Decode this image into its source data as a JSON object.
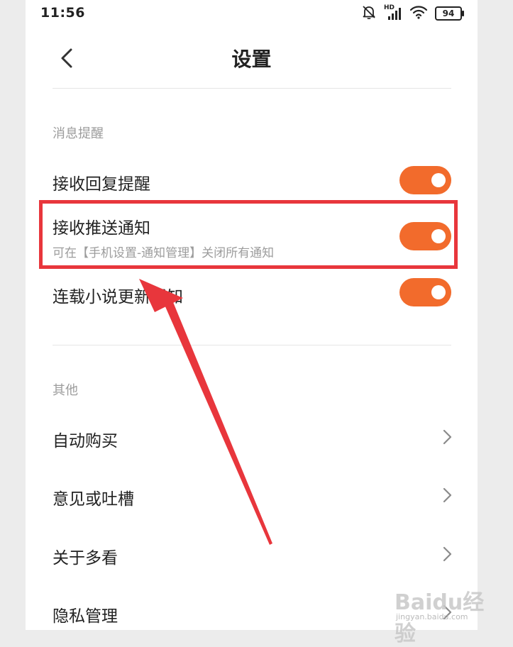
{
  "status_bar": {
    "time": "11:56",
    "network_label": "HD",
    "battery": "94"
  },
  "header": {
    "title": "设置"
  },
  "sections": {
    "notifications": {
      "title": "消息提醒",
      "items": [
        {
          "label": "接收回复提醒",
          "enabled": true
        },
        {
          "label": "接收推送通知",
          "subtitle": "可在【手机设置-通知管理】关闭所有通知",
          "enabled": true
        },
        {
          "label": "连载小说更新通知",
          "enabled": true
        }
      ]
    },
    "other": {
      "title": "其他",
      "items": [
        {
          "label": "自动购买"
        },
        {
          "label": "意见或吐槽"
        },
        {
          "label": "关于多看"
        },
        {
          "label": "隐私管理"
        }
      ]
    }
  },
  "watermark": {
    "main": "Baidu经验",
    "sub": "jingyan.baidu.com"
  },
  "colors": {
    "toggle_on": "#f26b2c",
    "annotation": "#e8363c"
  },
  "icons": [
    "back-arrow-icon",
    "mute-bell-icon",
    "signal-icon",
    "wifi-icon",
    "battery-icon",
    "chevron-right-icon"
  ]
}
